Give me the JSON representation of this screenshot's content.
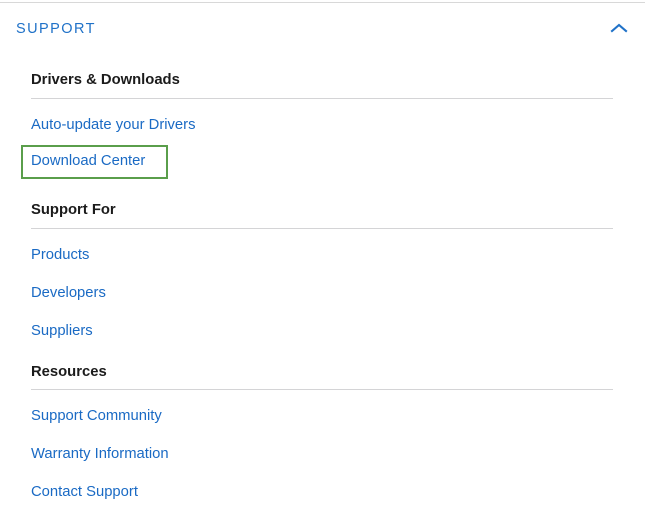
{
  "section": {
    "title": "SUPPORT",
    "chevron_icon": "chevron-up-icon",
    "expanded": true
  },
  "colors": {
    "link": "#1a6ac4",
    "section_title": "#2072c8",
    "heading": "#1b1b1b",
    "divider": "#d4d4d6",
    "focus_outline": "#5a9e4b",
    "background": "#ffffff"
  },
  "groups": [
    {
      "title": "Drivers & Downloads",
      "links": [
        {
          "label": "Auto-update your Drivers",
          "focused": false
        },
        {
          "label": "Download Center",
          "focused": true
        }
      ]
    },
    {
      "title": "Support For",
      "links": [
        {
          "label": "Products",
          "focused": false
        },
        {
          "label": "Developers",
          "focused": false
        },
        {
          "label": "Suppliers",
          "focused": false
        }
      ]
    },
    {
      "title": "Resources",
      "links": [
        {
          "label": "Support Community",
          "focused": false
        },
        {
          "label": "Warranty Information",
          "focused": false
        },
        {
          "label": "Contact Support",
          "focused": false
        }
      ]
    }
  ]
}
